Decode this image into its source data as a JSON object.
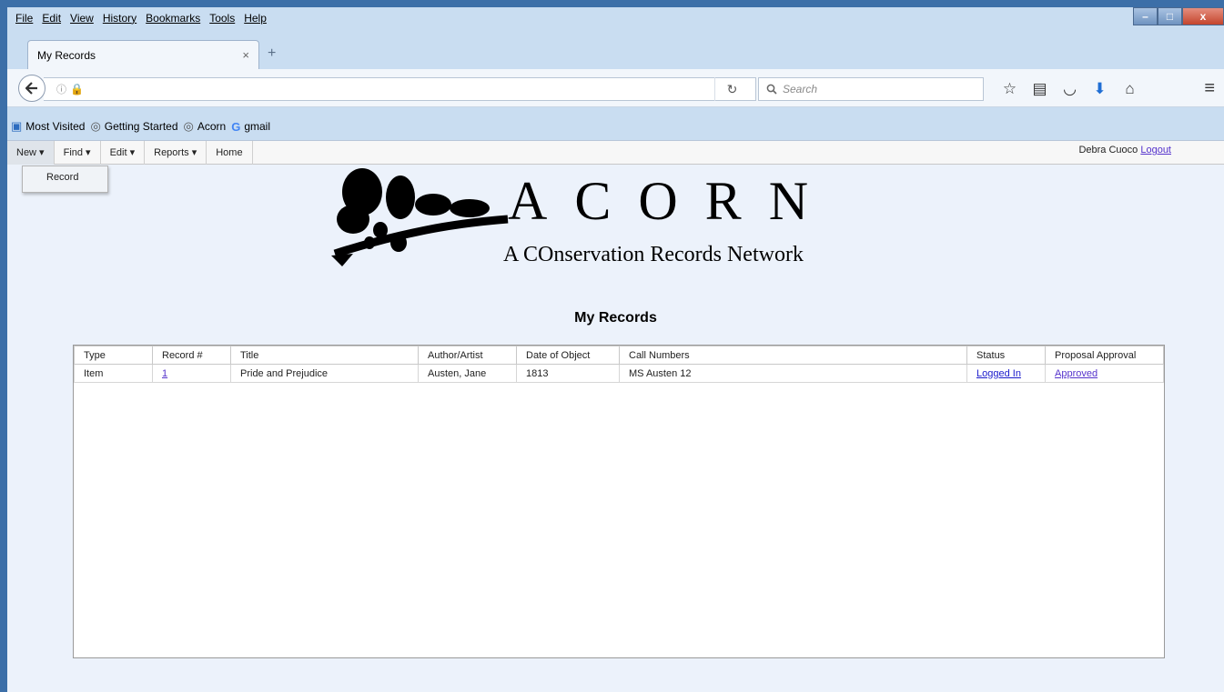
{
  "browser": {
    "menu": [
      "File",
      "Edit",
      "View",
      "History",
      "Bookmarks",
      "Tools",
      "Help"
    ],
    "window_controls": {
      "minimize": "–",
      "maximize": "□",
      "close": "x"
    },
    "tab": {
      "title": "My Records",
      "close": "×",
      "new": "+"
    },
    "url": {
      "value": ""
    },
    "search": {
      "placeholder": "Search"
    },
    "bookmarks": [
      "Most Visited",
      "Getting Started",
      "Acorn",
      "gmail"
    ]
  },
  "app": {
    "nav": [
      "New ▾",
      "Find ▾",
      "Edit ▾",
      "Reports ▾",
      "Home"
    ],
    "dropdown_item": "Record",
    "user": {
      "name": "Debra Cuoco",
      "logout": "Logout"
    },
    "logo": {
      "title": "ACORN",
      "subtitle": "A COnservation Records Network"
    },
    "page_title": "My Records",
    "table": {
      "headers": [
        "Type",
        "Record #",
        "Title",
        "Author/Artist",
        "Date of Object",
        "Call Numbers",
        "Status",
        "Proposal Approval"
      ],
      "rows": [
        {
          "type": "Item",
          "record": "1",
          "title": "Pride and Prejudice",
          "author": "Austen, Jane",
          "date": "1813",
          "call": "MS Austen 12",
          "status": "Logged In",
          "approval": "Approved"
        }
      ]
    }
  }
}
